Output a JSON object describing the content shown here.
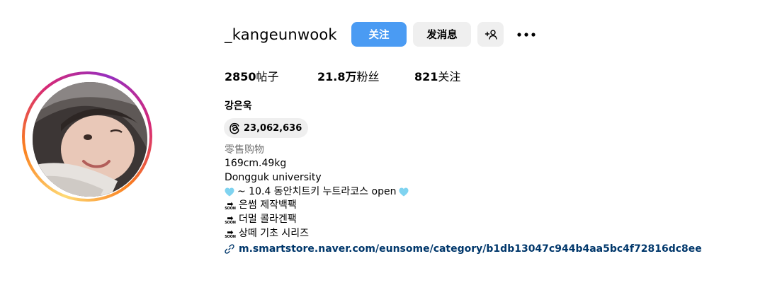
{
  "profile": {
    "username": "_kangeunwook",
    "full_name": "강은욱",
    "threads_count": "23,062,636",
    "category": "零售购物"
  },
  "actions": {
    "follow_label": "关注",
    "message_label": "发消息"
  },
  "stats": {
    "posts_num": "2850",
    "posts_label": "帖子",
    "followers_num": "21.8万",
    "followers_label": "粉丝",
    "following_num": "821",
    "following_label": "关注"
  },
  "bio": {
    "line1": "169cm.49kg",
    "line2": "Dongguk university",
    "line3": "~ 10.4 동안치트키 누트라코스 open",
    "soon_label": "SOON",
    "line4": "은썸 제작백팩",
    "line5": "더멀 콜라겐팩",
    "line6": "상떼 기초 시리즈",
    "link": "m.smartstore.naver.com/eunsome/category/b1db13047c944b4aa5bc4f72816dc8ee"
  },
  "colors": {
    "follow_button": "#4a9bf3",
    "secondary_button": "#efefef",
    "link": "#00376b",
    "category_text": "#737373",
    "heart": "#7fd3f0"
  },
  "icons": [
    "add-person-icon",
    "more-options-icon",
    "threads-icon",
    "link-icon",
    "light-blue-heart-icon",
    "soon-arrow-icon"
  ]
}
